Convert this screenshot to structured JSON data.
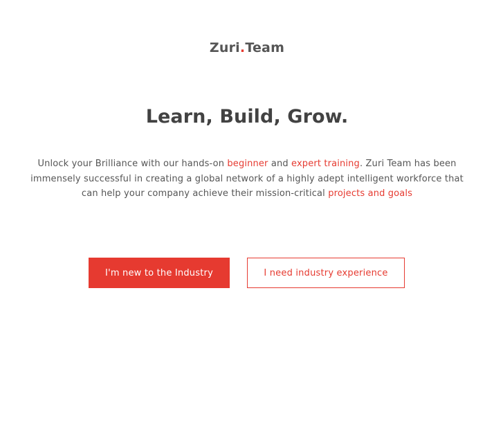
{
  "brand": {
    "name_part1": "Zuri",
    "dot": ".",
    "name_part2": "Team",
    "accent_color": "#e63a30"
  },
  "hero": {
    "title": "Learn, Build, Grow.",
    "intro_segments": {
      "s1": "Unlock your Brilliance with our hands-on ",
      "link1": "beginner",
      "s2": " and ",
      "link2": "expert training",
      "s3": ". Zuri Team has been immensely successful in creating a global network of a highly adept intelligent workforce that can help your company achieve their mission-critical ",
      "link3": "projects and goals"
    }
  },
  "actions": {
    "primary_label": "I'm new to the Industry",
    "secondary_label": "I need industry experience"
  }
}
